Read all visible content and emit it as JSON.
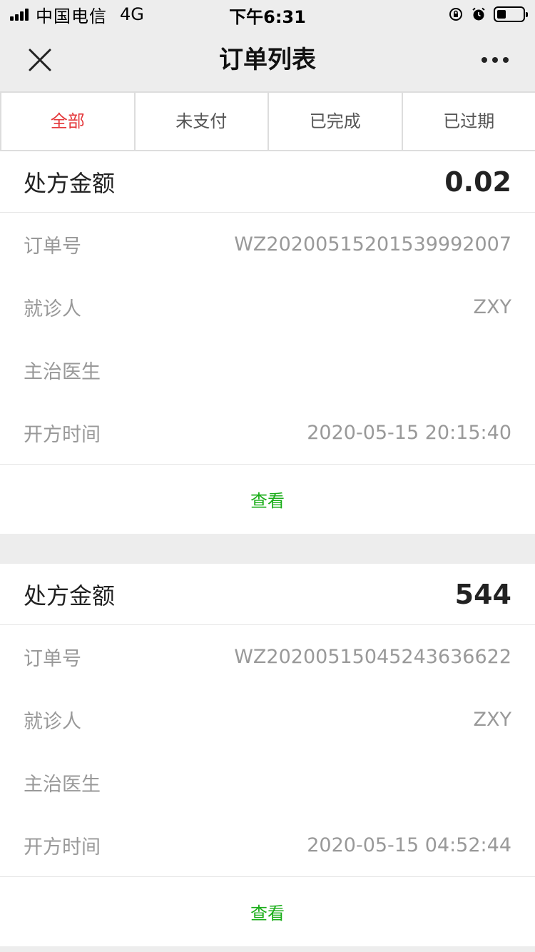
{
  "status_bar": {
    "carrier": "中国电信",
    "network": "4G",
    "time": "下午6:31"
  },
  "nav": {
    "title": "订单列表",
    "close_icon": "close-icon",
    "more_icon": "more-icon"
  },
  "tabs": [
    {
      "label": "全部",
      "active": true
    },
    {
      "label": "未支付",
      "active": false
    },
    {
      "label": "已完成",
      "active": false
    },
    {
      "label": "已过期",
      "active": false
    }
  ],
  "orders": [
    {
      "amount_label": "处方金额",
      "amount": "0.02",
      "rows": [
        {
          "label": "订单号",
          "value": "WZ20200515201539992007"
        },
        {
          "label": "就诊人",
          "value": "ZXY"
        },
        {
          "label": "主治医生",
          "value": ""
        },
        {
          "label": "开方时间",
          "value": "2020-05-15 20:15:40"
        }
      ],
      "action": "查看"
    },
    {
      "amount_label": "处方金额",
      "amount": "544",
      "rows": [
        {
          "label": "订单号",
          "value": "WZ20200515045243636622"
        },
        {
          "label": "就诊人",
          "value": "ZXY"
        },
        {
          "label": "主治医生",
          "value": ""
        },
        {
          "label": "开方时间",
          "value": "2020-05-15 04:52:44"
        }
      ],
      "action": "查看"
    }
  ],
  "colors": {
    "active_tab": "#e4393c",
    "view_link": "#1aad19",
    "background": "#ededed"
  }
}
